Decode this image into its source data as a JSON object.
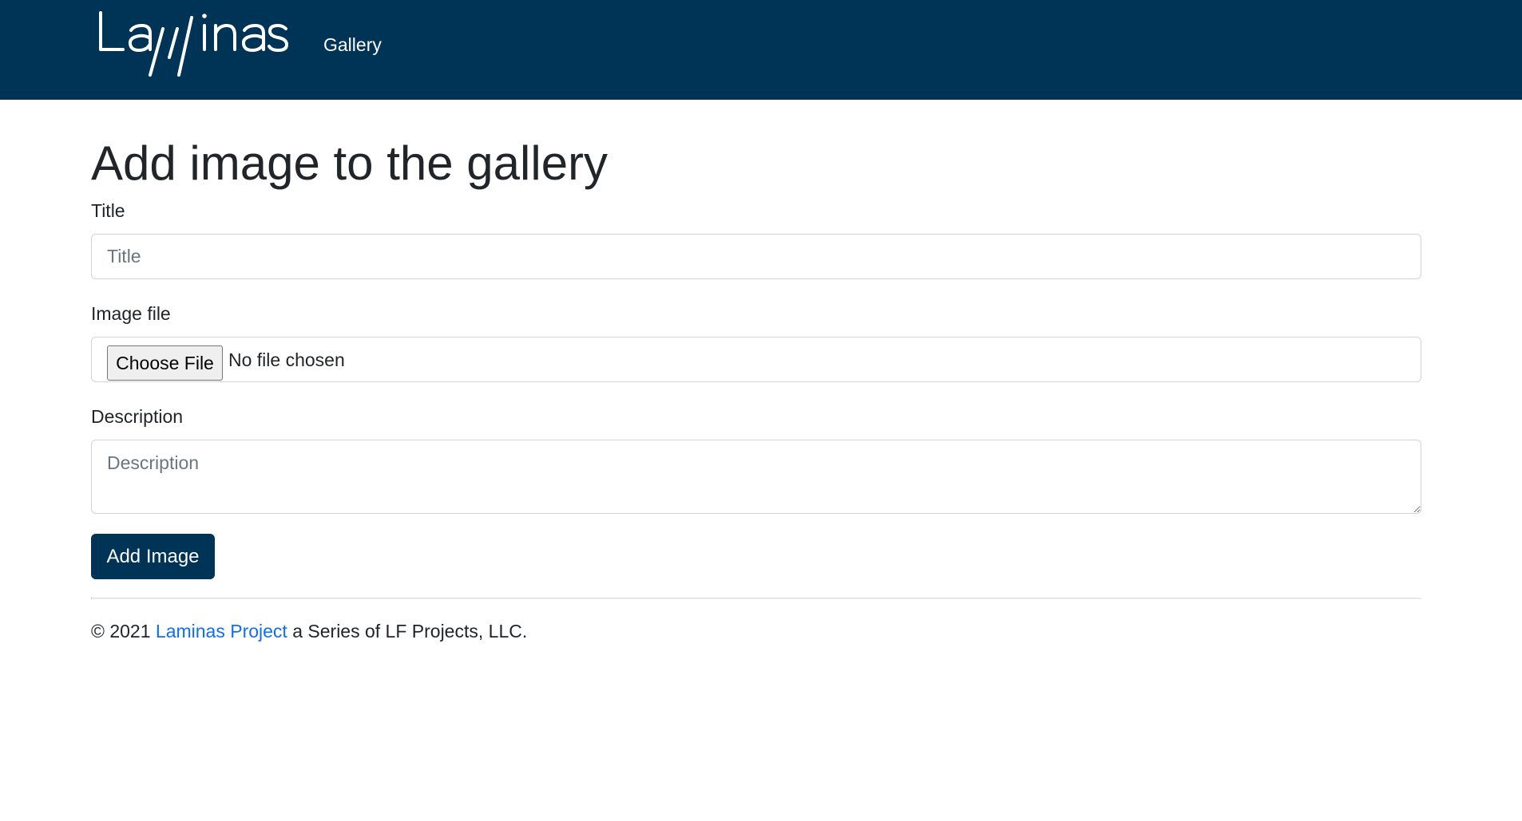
{
  "navbar": {
    "logo_text": "Laminas",
    "links": [
      {
        "label": "Gallery"
      }
    ],
    "background_color": "#003456"
  },
  "main": {
    "title": "Add image to the gallery",
    "form": {
      "title_label": "Title",
      "title_placeholder": "Title",
      "title_value": "",
      "image_label": "Image file",
      "file_button_label": "Choose File",
      "file_status": "No file chosen",
      "description_label": "Description",
      "description_placeholder": "Description",
      "description_value": "",
      "submit_label": "Add Image"
    }
  },
  "footer": {
    "prefix": "© 2021 ",
    "link_text": "Laminas Project",
    "suffix": " a Series of LF Projects, LLC.",
    "link_color": "#0d6efd"
  },
  "colors": {
    "brand": "#003456",
    "link": "#0d6efd",
    "text": "#212529"
  }
}
